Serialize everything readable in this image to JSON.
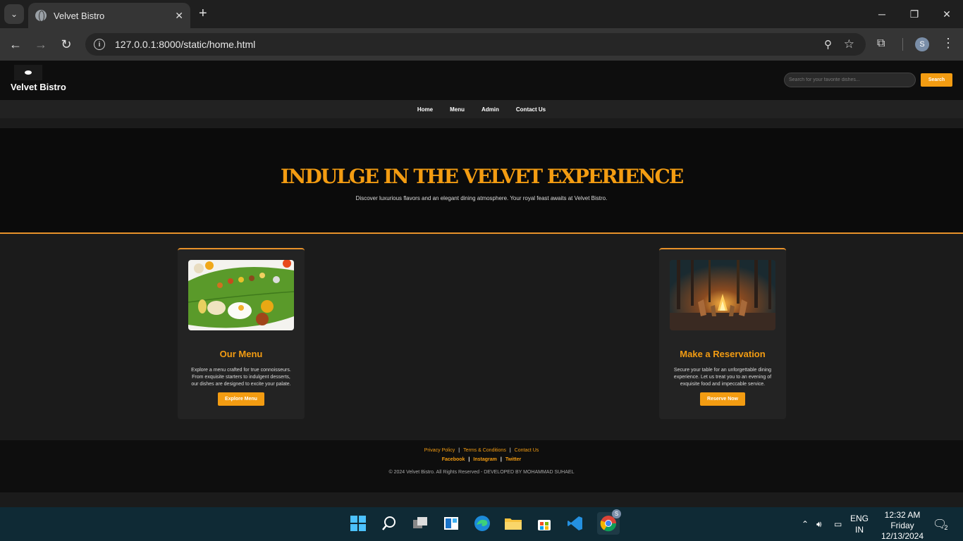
{
  "browser": {
    "tab_title": "Velvet Bistro",
    "url": "127.0.0.1:8000/static/home.html",
    "profile_initial": "S"
  },
  "site": {
    "brand": "Velvet Bistro",
    "search_placeholder": "Search for your favorite dishes...",
    "search_button": "Search",
    "nav": [
      "Home",
      "Menu",
      "Admin",
      "Contact Us"
    ],
    "hero_title": "INDULGE IN THE VELVET EXPERIENCE",
    "hero_subtitle": "Discover luxurious flavors and an elegant dining atmosphere. Your royal feast awaits at Velvet Bistro.",
    "cards": [
      {
        "title": "Our Menu",
        "text": "Explore a menu crafted for true connoisseurs. From exquisite starters to indulgent desserts, our dishes are designed to excite your palate.",
        "button": "Explore Menu"
      },
      {
        "title": "Make a Reservation",
        "text": "Secure your table for an unforgettable dining experience. Let us treat you to an evening of exquisite food and impeccable service.",
        "button": "Reserve Now"
      }
    ],
    "footer": {
      "links": [
        "Privacy Policy",
        "Terms & Conditions",
        "Contact Us"
      ],
      "social": [
        "Facebook",
        "Instagram",
        "Twitter"
      ],
      "copyright": "© 2024 Velvet Bistro. All Rights Reserved - DEVELOPED BY MOHAMMAD SUHAEL"
    },
    "accent_color": "#f39c12"
  },
  "taskbar": {
    "lang_top": "ENG",
    "lang_bottom": "IN",
    "time": "12:32 AM",
    "day": "Friday",
    "date": "12/13/2024",
    "notification_count": "2",
    "chrome_badge": "S"
  }
}
